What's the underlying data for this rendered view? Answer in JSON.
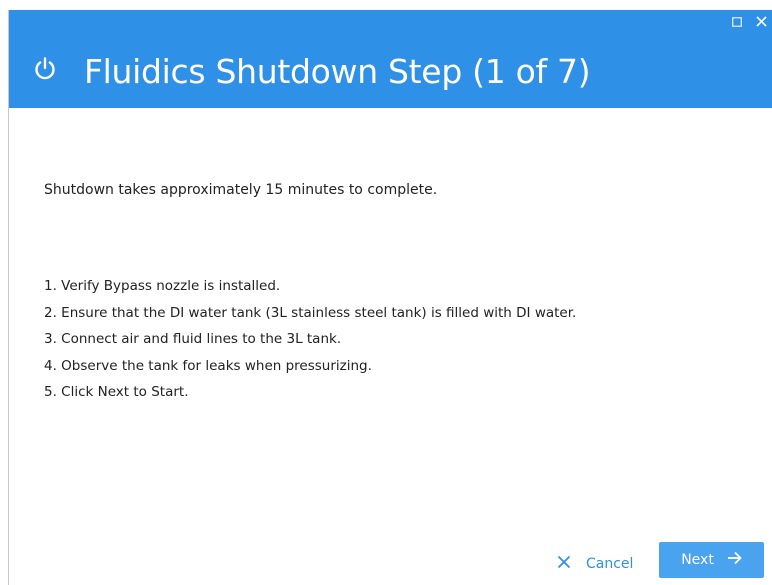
{
  "window": {
    "title": "Fluidics Shutdown Step (1 of 7)",
    "header_color": "#2f90e8"
  },
  "content": {
    "intro": "Shutdown takes approximately 15 minutes to complete.",
    "steps": [
      "1. Verify Bypass nozzle is installed.",
      "2. Ensure that the DI water tank (3L stainless steel tank) is filled with DI water.",
      "3. Connect air and fluid lines to the 3L tank.",
      "4. Observe the tank for leaks when pressurizing.",
      "5. Click Next to Start."
    ]
  },
  "footer": {
    "cancel_label": "Cancel",
    "next_label": "Next",
    "accent_color": "#2f90e8",
    "next_button_color": "#4aa3ee"
  },
  "icons": {
    "title_icon": "power-icon",
    "maximize": "maximize-icon",
    "close": "close-icon",
    "cancel": "close-icon",
    "next": "arrow-right-icon"
  }
}
